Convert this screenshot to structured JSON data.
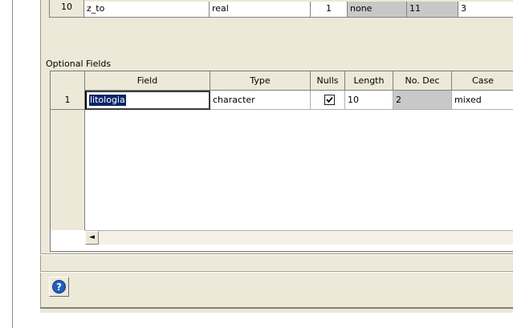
{
  "required_fields": {
    "last_row": {
      "number": "10",
      "field": "z_to",
      "type": "real",
      "nulls": "1",
      "length": "none",
      "no_dec": "11",
      "case": "3"
    }
  },
  "optional_fields": {
    "label": "Optional Fields",
    "columns": [
      "Field",
      "Type",
      "Nulls",
      "Length",
      "No. Dec",
      "Case"
    ],
    "rows": [
      {
        "number": "1",
        "field": "litologia",
        "type": "character",
        "nulls_checked": true,
        "length": "10",
        "no_dec": "2",
        "case": "mixed"
      }
    ]
  },
  "scrollbar": {
    "left_arrow": "◄"
  },
  "help_button": {
    "icon": "help-icon",
    "glyph": "?"
  },
  "colors": {
    "window_bg": "#ece9d8",
    "selection": "#0a246a",
    "help_blue": "#1f5fbf"
  }
}
